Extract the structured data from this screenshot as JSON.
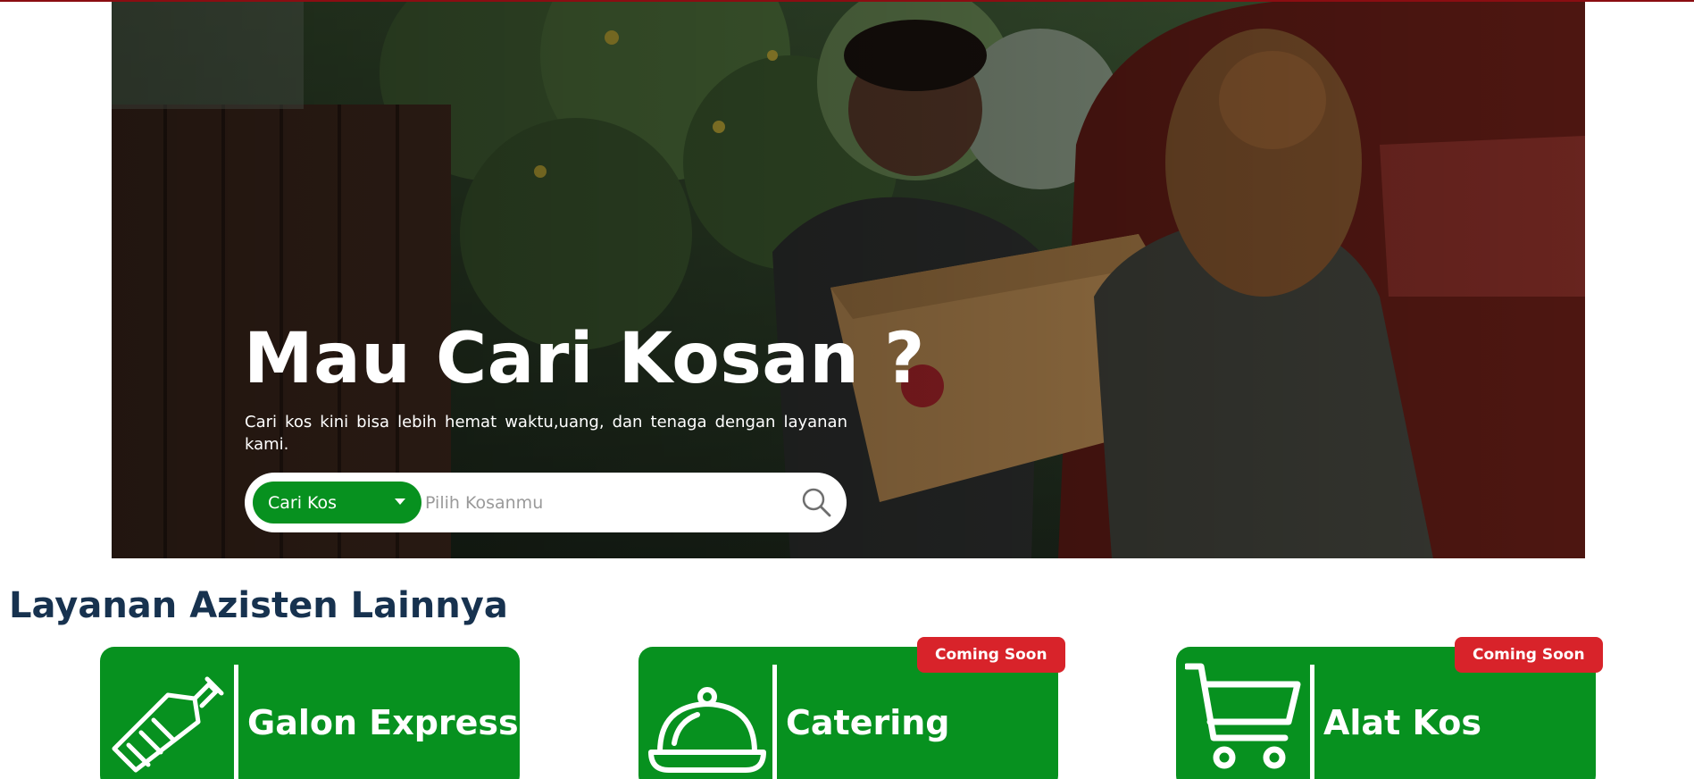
{
  "hero": {
    "title": "Mau Cari Kosan ?",
    "subtitle": "Cari kos kini bisa lebih hemat waktu,uang, dan tenaga dengan layanan kami."
  },
  "search": {
    "select_label": "Cari Kos",
    "placeholder": "Pilih Kosanmu",
    "icon": "search-icon"
  },
  "services": {
    "title": "Layanan Azisten Lainnya",
    "items": [
      {
        "label": "Galon Express",
        "icon": "water-gallon-icon",
        "badge": ""
      },
      {
        "label": "Catering",
        "icon": "food-cloche-icon",
        "badge": "Coming Soon"
      },
      {
        "label": "Alat Kos",
        "icon": "shopping-cart-icon",
        "badge": "Coming Soon"
      }
    ]
  },
  "colors": {
    "accent_green": "#07911f",
    "badge_red": "#d8232a",
    "heading_navy": "#17324f",
    "top_line": "#8b0d12"
  }
}
